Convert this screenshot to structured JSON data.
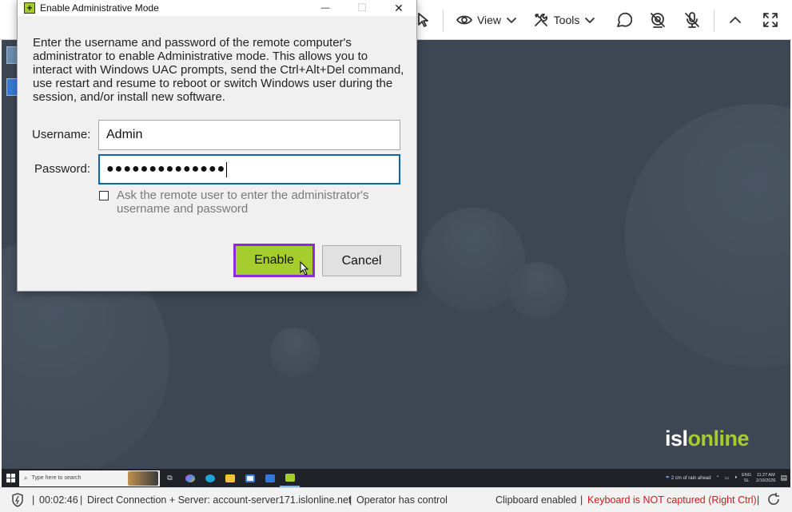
{
  "toolbar": {
    "view_label": "View",
    "tools_label": "Tools"
  },
  "dialog": {
    "title": "Enable Administrative Mode",
    "description": "Enter the username and password of the remote computer's administrator to enable Administrative mode. This allows you to interact with Windows UAC prompts, send the Ctrl+Alt+Del command, use restart and resume to reboot or switch Windows user during the session, and/or install new software.",
    "username_label": "Username:",
    "username_value": "Admin",
    "password_label": "Password:",
    "password_value": "●●●●●●●●●●●●●●",
    "ask_remote_label": "Ask the remote user to enter the administrator's username and password",
    "ask_remote_checked": false,
    "enable_label": "Enable",
    "cancel_label": "Cancel",
    "minimize_glyph": "—",
    "maximize_glyph": "☐",
    "close_glyph": "✕"
  },
  "remote_desktop": {
    "logo_part1": "isl",
    "logo_part2": "online",
    "taskbar": {
      "search_placeholder": "Type here to search",
      "weather": "2 cm of rain ahead",
      "language_line1": "ENG",
      "language_line2": "SL",
      "time": "11:27 AM",
      "date": "2/19/2026"
    }
  },
  "statusbar": {
    "timer": "00:02:46",
    "connection": "Direct Connection + Server: account-server171.islonline.net",
    "control": "Operator has control",
    "clipboard": "Clipboard enabled",
    "keyboard": "Keyboard is NOT captured",
    "keyboard_hint": "(Right Ctrl)",
    "separator": "|"
  },
  "colors": {
    "accent_green": "#a6cd2e",
    "highlight_purple": "#8a2be2",
    "desktop_bg": "#3d4753",
    "warning_red": "#d8161b"
  }
}
